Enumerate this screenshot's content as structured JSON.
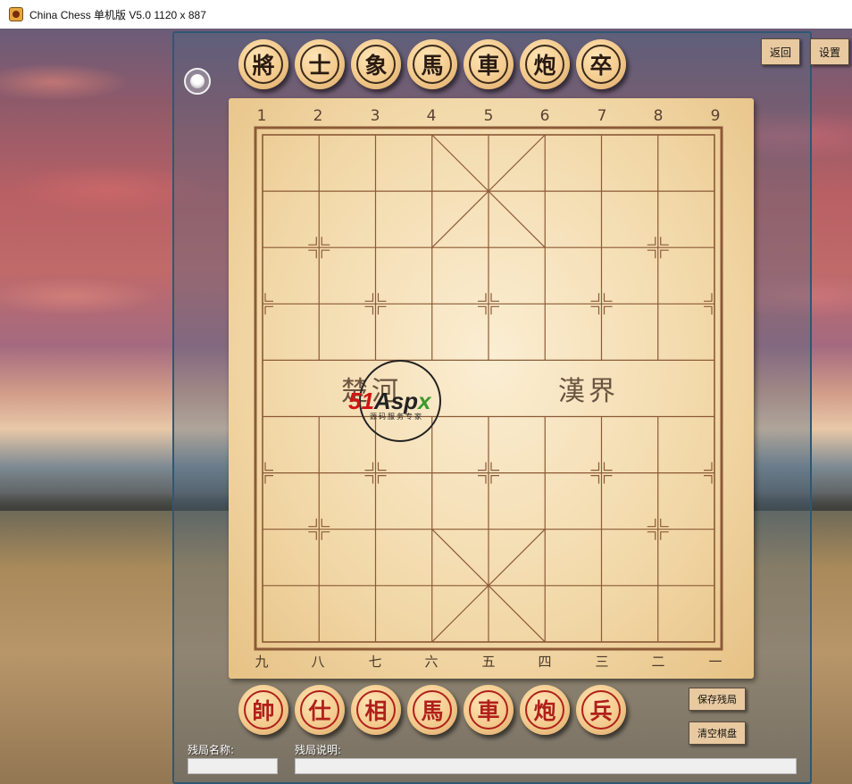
{
  "window": {
    "title": "China Chess 单机版 V5.0  1120 x 887"
  },
  "toolbar": {
    "back_label": "返回",
    "settings_label": "设置"
  },
  "pieces": {
    "black": [
      "將",
      "士",
      "象",
      "馬",
      "車",
      "炮",
      "卒"
    ],
    "red": [
      "帥",
      "仕",
      "相",
      "馬",
      "車",
      "炮",
      "兵"
    ]
  },
  "board": {
    "top_numbers": [
      "1",
      "2",
      "3",
      "4",
      "5",
      "6",
      "7",
      "8",
      "9"
    ],
    "bottom_numbers": [
      "九",
      "八",
      "七",
      "六",
      "五",
      "四",
      "三",
      "二",
      "一"
    ],
    "river_left": "楚河",
    "river_right": "漢界"
  },
  "watermark": {
    "brand_red": "51",
    "brand_black": "Asp",
    "brand_green": "x",
    "subtitle": "源码服务专家"
  },
  "actions": {
    "save_label": "保存残局",
    "clear_label": "清空棋盘"
  },
  "form": {
    "name_label": "残局名称:",
    "name_value": "",
    "desc_label": "残局说明:",
    "desc_value": ""
  },
  "colors": {
    "board_wood": "#f2d8a8",
    "grid_line": "#8b5a36",
    "red_piece_text": "#b0201a",
    "black_piece_text": "#2a1a10",
    "button_bg": "#e8c9a0",
    "panel_border": "#2e5872"
  }
}
